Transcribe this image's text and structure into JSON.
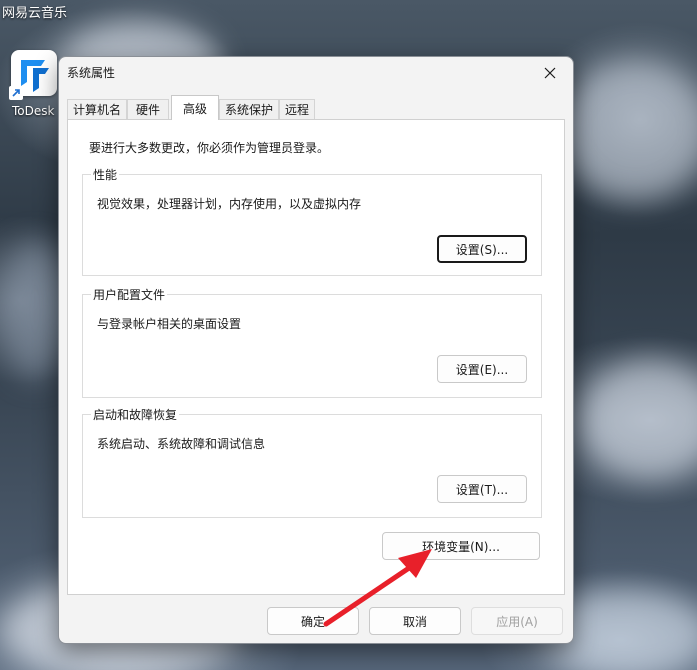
{
  "desktop": {
    "top_app_label": "网易云音乐",
    "shortcut_label": "ToDesk"
  },
  "dialog": {
    "title": "系统属性",
    "tabs": [
      {
        "label": "计算机名"
      },
      {
        "label": "硬件"
      },
      {
        "label": "高级"
      },
      {
        "label": "系统保护"
      },
      {
        "label": "远程"
      }
    ],
    "active_tab": "高级",
    "admin_note": "要进行大多数更改，你必须作为管理员登录。",
    "groups": {
      "performance": {
        "title": "性能",
        "description": "视觉效果，处理器计划，内存使用，以及虚拟内存",
        "button": "设置(S)..."
      },
      "user_profiles": {
        "title": "用户配置文件",
        "description": "与登录帐户相关的桌面设置",
        "button": "设置(E)..."
      },
      "startup_recovery": {
        "title": "启动和故障恢复",
        "description": "系统启动、系统故障和调试信息",
        "button": "设置(T)..."
      }
    },
    "env_button": "环境变量(N)...",
    "footer": {
      "ok": "确定",
      "cancel": "取消",
      "apply": "应用(A)"
    }
  },
  "colors": {
    "annotation_arrow": "#e8202a",
    "todesk_blue": "#1e8ef0"
  },
  "icons": {
    "close": "close-icon",
    "shortcut_overlay": "shortcut-arrow-icon",
    "app": "todesk-app-icon"
  }
}
